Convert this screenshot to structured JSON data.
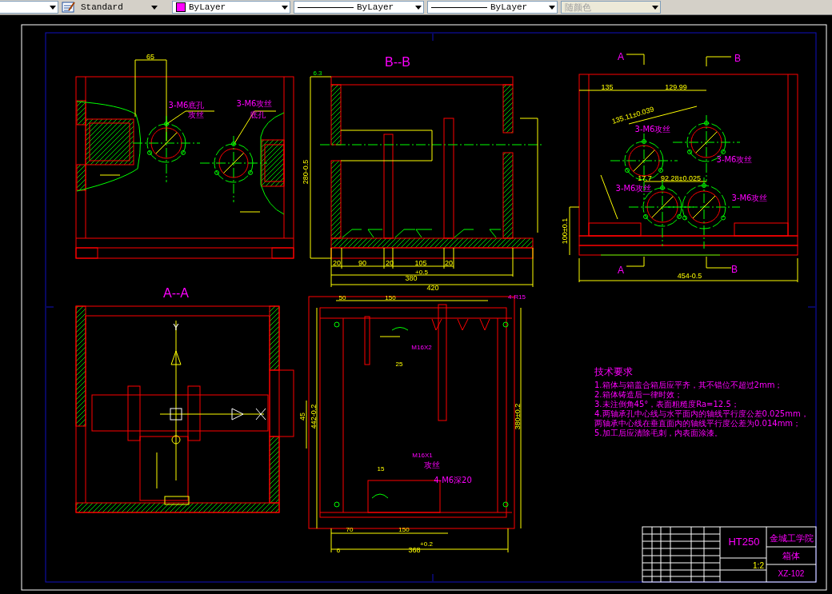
{
  "toolbar": {
    "items": [
      {
        "kind": "combo"
      },
      {
        "kind": "icon"
      },
      {
        "kind": "combo",
        "value": "Standard"
      },
      {
        "kind": "color",
        "value": "ByLayer",
        "color": "#ff00ff"
      },
      {
        "kind": "linetype",
        "value": "ByLayer"
      },
      {
        "kind": "linetype",
        "value": "ByLayer"
      },
      {
        "kind": "plotstyle",
        "value": "随颜色",
        "disabled": true
      }
    ]
  },
  "sheet": {
    "views": [
      {
        "kind": "front",
        "labels": [
          "65",
          "3-M6底孔",
          "攻丝",
          "3-M6攻丝",
          "底孔"
        ]
      },
      {
        "kind": "section_b",
        "labels": [
          "B--B",
          "20",
          "90",
          "20",
          "105",
          "20",
          "380",
          "+0.5",
          "420",
          "280-0.5",
          "6.3"
        ]
      },
      {
        "kind": "side",
        "labels": [
          "A",
          "B",
          "135",
          "129.99",
          "135.11±0.039",
          "3-M6攻丝",
          "3-M6攻丝",
          "3-M6攻丝",
          "3-M6攻丝",
          "17.7",
          "92.28±0.025",
          "A",
          "B",
          "454-0.5",
          "100±0.1"
        ]
      },
      {
        "kind": "section_a",
        "labels": [
          "A--A",
          "Y"
        ]
      },
      {
        "kind": "top",
        "labels": [
          "50",
          "150",
          "4-R15",
          "M16X2",
          "25",
          "15",
          "M16X1",
          "攻丝",
          "4-M6深20",
          "70",
          "150",
          "368",
          "+0.2",
          "6",
          "442-0.2",
          "380±0.2",
          "45"
        ]
      }
    ],
    "notes": {
      "title": "技术要求",
      "lines": [
        "1.箱体与箱盖合箱后应平齐，其不错位不超过2mm；",
        "2.箱体铸造后一律时效；",
        "3.未注倒角45°，表面粗糙度Ra=12.5；",
        "4.两轴承孔中心线与水平面内的轴线平行度公差0.025mm，",
        "  两轴承中心线在垂直面内的轴线平行度公差为0.014mm；",
        "5.加工后应清除毛刺，内表面涂漆。"
      ]
    },
    "title_block": {
      "material": "HT250",
      "school": "金城工学院",
      "part_name": "箱体",
      "drawing_no": "XZ-102",
      "scale": "1:2"
    }
  }
}
